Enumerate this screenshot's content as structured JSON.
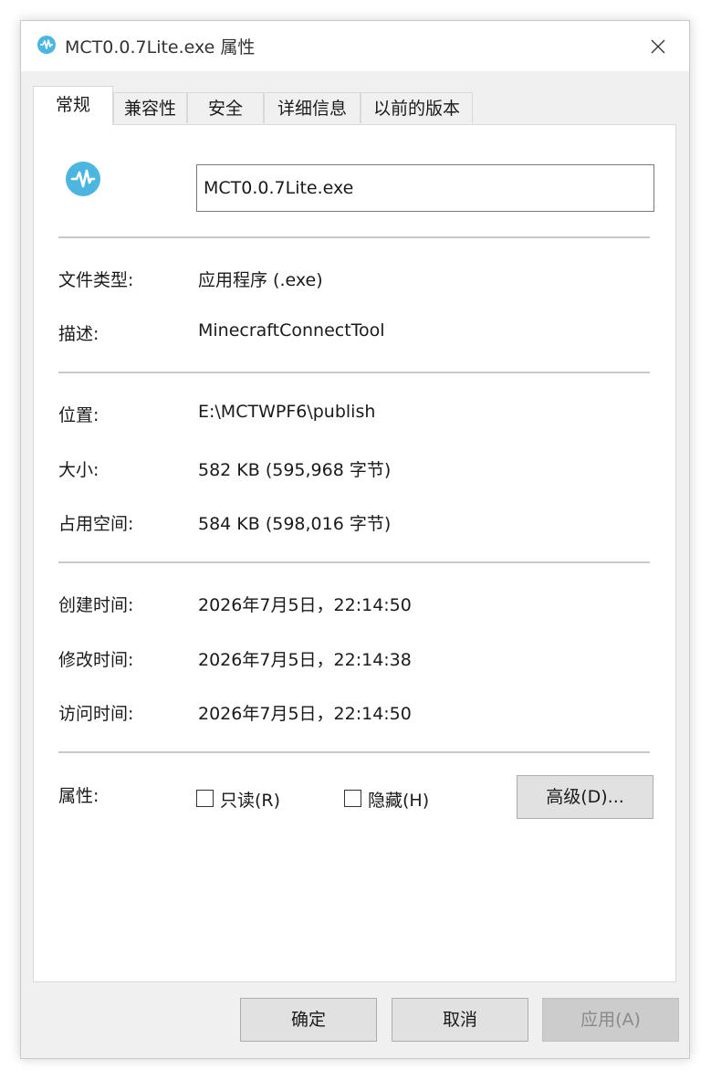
{
  "window": {
    "title": "MCT0.0.7Lite.exe 属性",
    "accent_color": "#4cb6e0"
  },
  "tabs": [
    {
      "label": "常规",
      "active": true
    },
    {
      "label": "兼容性",
      "active": false
    },
    {
      "label": "安全",
      "active": false
    },
    {
      "label": "详细信息",
      "active": false
    },
    {
      "label": "以前的版本",
      "active": false
    }
  ],
  "general": {
    "file_name": "MCT0.0.7Lite.exe",
    "rows": {
      "file_type": {
        "label": "文件类型:",
        "value": "应用程序 (.exe)"
      },
      "description": {
        "label": "描述:",
        "value": "MinecraftConnectTool"
      },
      "location": {
        "label": "位置:",
        "value": "E:\\MCTWPF6\\publish"
      },
      "size": {
        "label": "大小:",
        "value": "582 KB (595,968 字节)"
      },
      "size_on_disk": {
        "label": "占用空间:",
        "value": "584 KB (598,016 字节)"
      },
      "created": {
        "label": "创建时间:",
        "value": "2026年7月5日，22:14:50"
      },
      "modified": {
        "label": "修改时间:",
        "value": "2026年7月5日，22:14:38"
      },
      "accessed": {
        "label": "访问时间:",
        "value": "2026年7月5日，22:14:50"
      }
    },
    "attributes": {
      "label": "属性:",
      "readonly_label": "只读(R)",
      "readonly_checked": false,
      "hidden_label": "隐藏(H)",
      "hidden_checked": false,
      "advanced_label": "高级(D)..."
    }
  },
  "footer": {
    "ok_label": "确定",
    "cancel_label": "取消",
    "apply_label": "应用(A)",
    "apply_disabled": true
  }
}
